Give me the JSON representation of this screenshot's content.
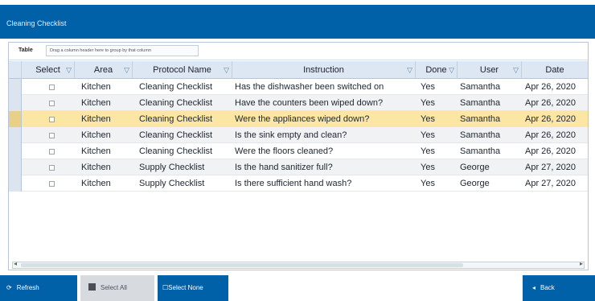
{
  "window": {
    "title": "Cleaning Checklist"
  },
  "toolbar": {
    "label": "Table",
    "group_hint": "Drag a column header here to group by that column"
  },
  "grid": {
    "columns": [
      "Select",
      "Area",
      "Protocol Name",
      "Instruction",
      "Done",
      "User",
      "Date"
    ],
    "rows": [
      {
        "area": "Kitchen",
        "protocol": "Cleaning Checklist",
        "instruction": "Has the dishwasher been switched on",
        "done": "Yes",
        "user": "Samantha",
        "date": "Apr 26, 2020"
      },
      {
        "area": "Kitchen",
        "protocol": "Cleaning Checklist",
        "instruction": "Have the counters been wiped down?",
        "done": "Yes",
        "user": "Samantha",
        "date": "Apr 26, 2020"
      },
      {
        "area": "Kitchen",
        "protocol": "Cleaning Checklist",
        "instruction": "Were the appliances wiped down?",
        "done": "Yes",
        "user": "Samantha",
        "date": "Apr 26, 2020"
      },
      {
        "area": "Kitchen",
        "protocol": "Cleaning Checklist",
        "instruction": "Is the sink empty and clean?",
        "done": "Yes",
        "user": "Samantha",
        "date": "Apr 26, 2020"
      },
      {
        "area": "Kitchen",
        "protocol": "Cleaning Checklist",
        "instruction": "Were the floors cleaned?",
        "done": "Yes",
        "user": "Samantha",
        "date": "Apr 26, 2020"
      },
      {
        "area": "Kitchen",
        "protocol": "Supply Checklist",
        "instruction": "Is the hand sanitizer full?",
        "done": "Yes",
        "user": "George",
        "date": "Apr 27, 2020"
      },
      {
        "area": "Kitchen",
        "protocol": "Supply Checklist",
        "instruction": "Is there sufficient hand wash?",
        "done": "Yes",
        "user": "George",
        "date": "Apr 27, 2020"
      }
    ],
    "selected_row": 2
  },
  "buttons": {
    "refresh": "Refresh",
    "select_all": "Select All",
    "select_none": "Select None",
    "back": "Back"
  },
  "colors": {
    "accent": "#0060a8",
    "selected_row": "#fbe6a3",
    "header": "#dde7f3"
  }
}
